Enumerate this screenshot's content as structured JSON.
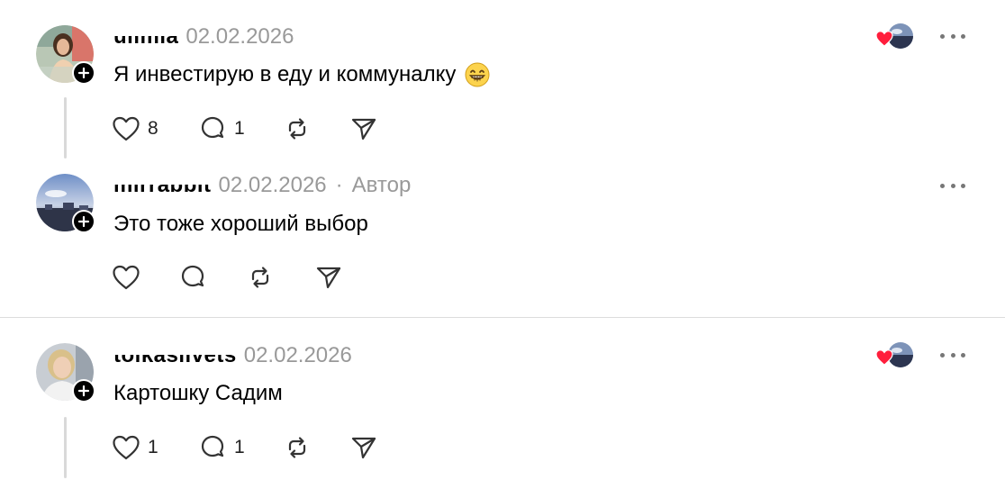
{
  "posts": [
    {
      "username": "ulimia",
      "date": "02.02.2026",
      "text": "Я инвестирую в еду и коммуналку",
      "emoji": "grinning-face-with-smiling-eyes",
      "likes": "8",
      "replies": "1",
      "author_tag": "",
      "liked_by_author": true
    },
    {
      "username": "mirrabbit",
      "date": "02.02.2026",
      "text": "Это тоже хороший выбор",
      "likes": "",
      "replies": "",
      "author_separator": "·",
      "author_tag": "Автор",
      "liked_by_author": false
    },
    {
      "username": "tolkaslivets",
      "date": "02.02.2026",
      "text": "Картошку Садим",
      "likes": "1",
      "replies": "1",
      "author_tag": "",
      "liked_by_author": true
    }
  ],
  "colors": {
    "heart_red": "#ff1e3c",
    "muted": "#999999",
    "icon": "#333333"
  }
}
